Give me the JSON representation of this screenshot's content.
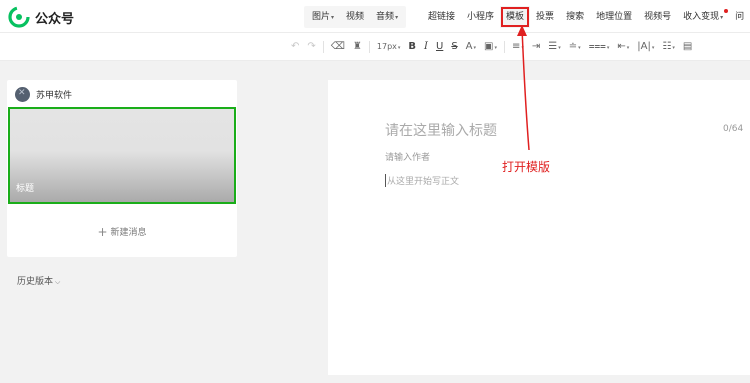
{
  "header": {
    "brand": "公众号",
    "media_menu": [
      {
        "label": "图片",
        "dropdown": true
      },
      {
        "label": "视频",
        "dropdown": false
      },
      {
        "label": "音频",
        "dropdown": true
      }
    ],
    "insert_menu": [
      {
        "label": "超链接"
      },
      {
        "label": "小程序"
      },
      {
        "label": "模板",
        "highlighted": true
      },
      {
        "label": "投票"
      },
      {
        "label": "搜索"
      },
      {
        "label": "地理位置"
      },
      {
        "label": "视频号"
      },
      {
        "label": "收入变现",
        "dropdown": true,
        "badge": true
      },
      {
        "label": "问"
      }
    ]
  },
  "toolbar": {
    "font_size": "17px",
    "items": [
      "undo-icon",
      "redo-icon",
      "clear-format-icon",
      "format-painter-icon",
      "font-size-select",
      "bold-icon",
      "italic-icon",
      "underline-icon",
      "strikethrough-icon",
      "font-color-icon",
      "background-color-icon",
      "align-left-icon",
      "indent-icon",
      "align-center-icon",
      "line-height-icon",
      "paragraph-spacing-icon",
      "letter-spacing-icon",
      "bulleted-list-icon",
      "more-icon"
    ]
  },
  "sidebar": {
    "account_name": "苏甲软件",
    "article_title": "标题",
    "new_message_label": "新建消息",
    "history_label": "历史版本"
  },
  "editor": {
    "title_placeholder": "请在这里输入标题",
    "title_counter": "0/64",
    "author_placeholder": "请输入作者",
    "body_placeholder": "从这里开始写正文"
  },
  "annotation": {
    "label": "打开模版",
    "color": "#e02020"
  },
  "colors": {
    "accent_green": "#1aad19",
    "annotation_red": "#e02020"
  }
}
